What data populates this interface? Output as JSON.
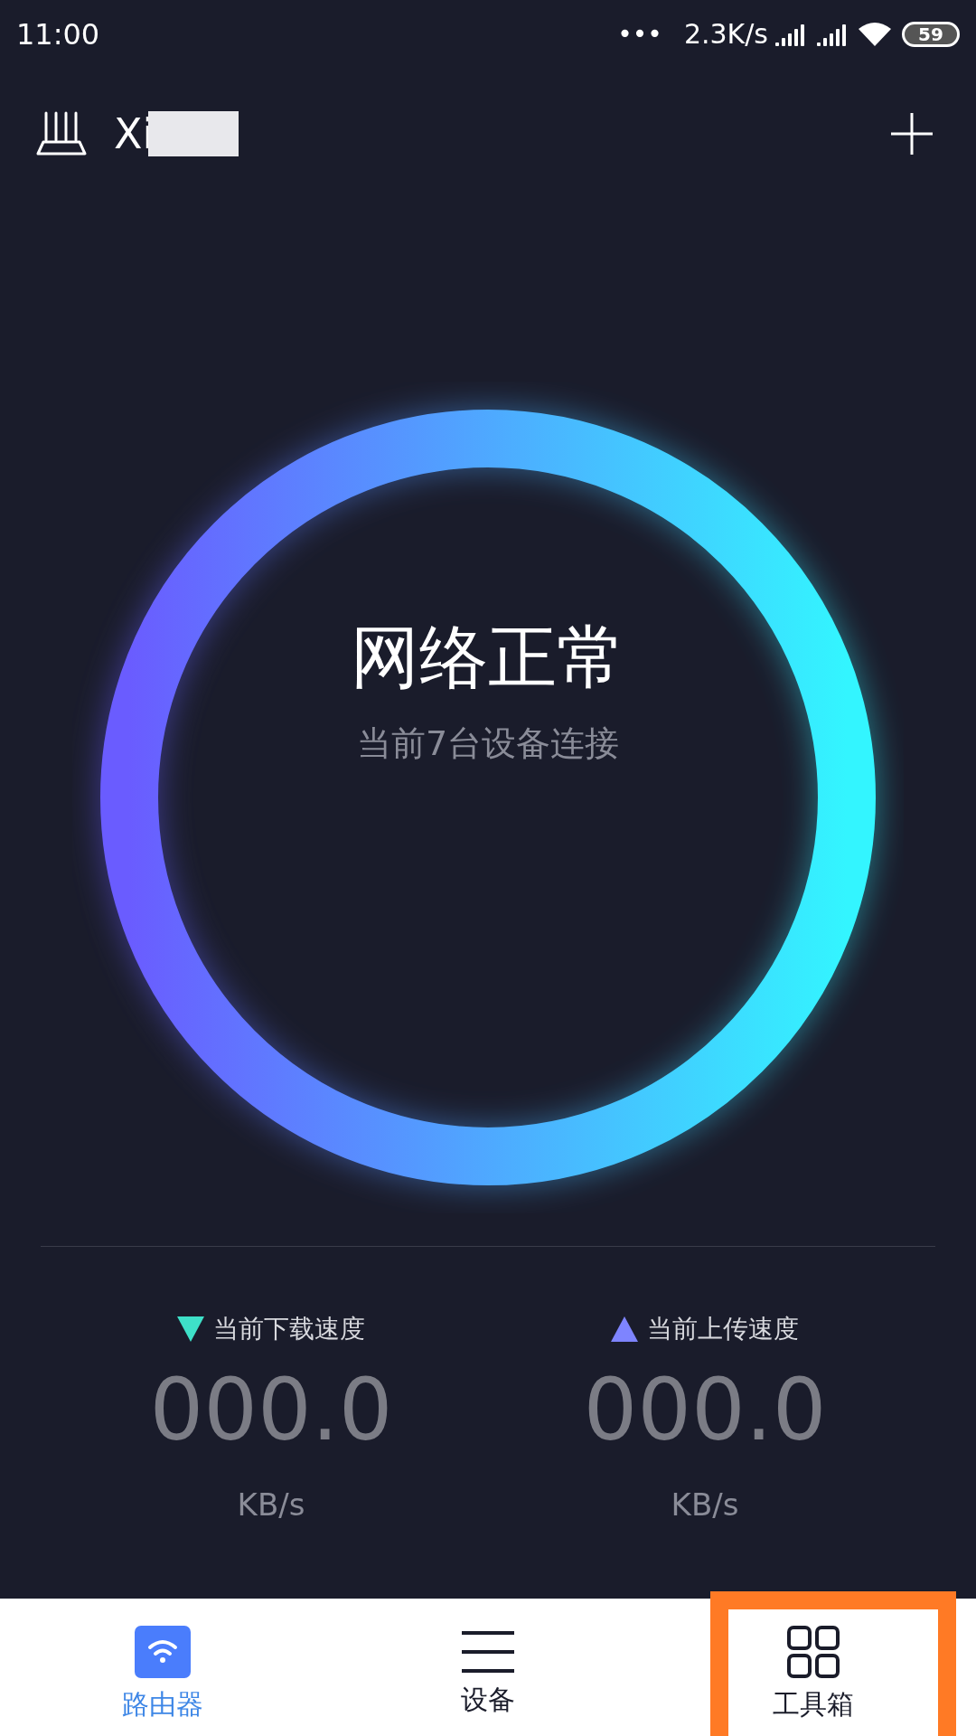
{
  "status_bar": {
    "time": "11:00",
    "more": "•••",
    "speed": "2.3K/s",
    "battery": "59"
  },
  "header": {
    "router_name": "Xi"
  },
  "status": {
    "title": "网络正常",
    "subtitle": "当前7台设备连接"
  },
  "speeds": [
    {
      "kind": "download",
      "label": "当前下载速度",
      "value": "000.0",
      "unit": "KB/s",
      "color": "#3ee0c8"
    },
    {
      "kind": "upload",
      "label": "当前上传速度",
      "value": "000.0",
      "unit": "KB/s",
      "color": "#7e84ff"
    }
  ],
  "tabs": [
    {
      "kind": "router",
      "label": "路由器",
      "selected": true,
      "highlighted": false
    },
    {
      "kind": "devices",
      "label": "设备",
      "selected": false,
      "highlighted": false
    },
    {
      "kind": "toolbox",
      "label": "工具箱",
      "selected": false,
      "highlighted": true
    }
  ]
}
